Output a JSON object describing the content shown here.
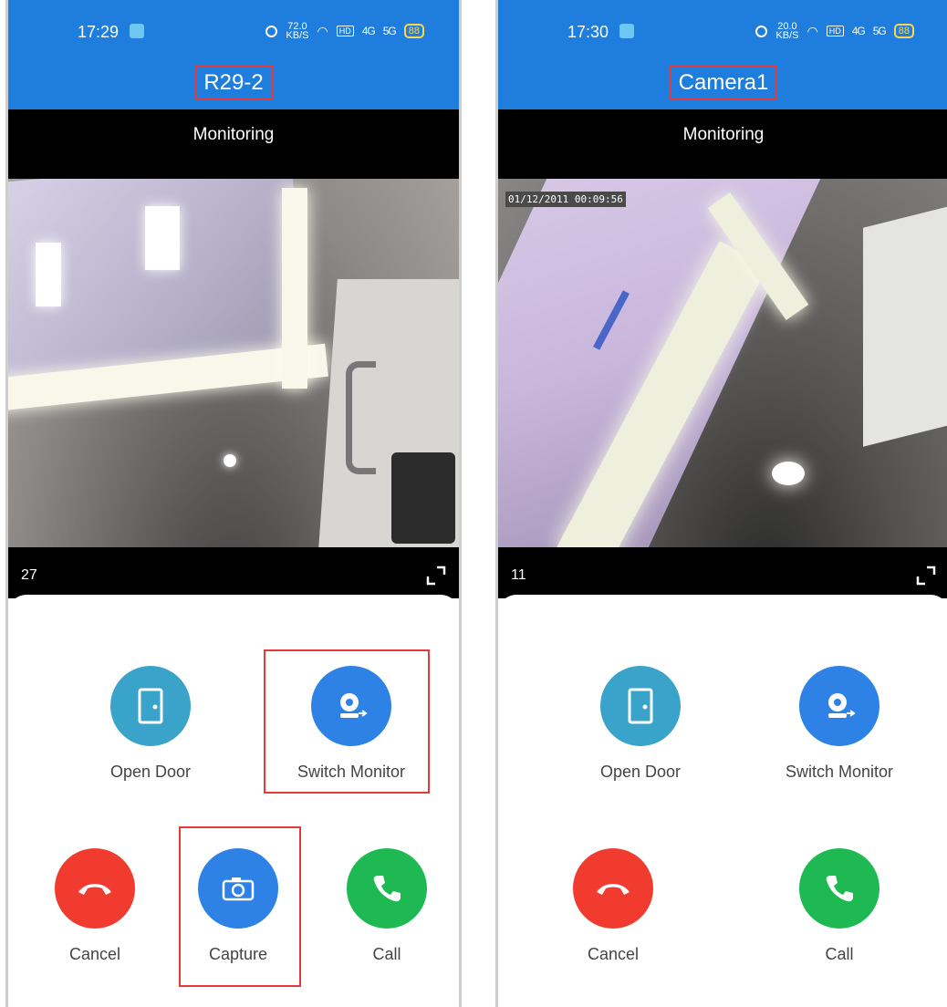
{
  "left_screen": {
    "status": {
      "time": "17:29",
      "speed": "72.0",
      "speed_unit": "KB/S",
      "hd": "HD",
      "sig1": "4G",
      "sig2": "5G",
      "battery": "88"
    },
    "title": "R29-2",
    "monitoring": "Monitoring",
    "counter": "27",
    "actions": {
      "open_door": "Open Door",
      "switch_monitor": "Switch Monitor",
      "cancel": "Cancel",
      "capture": "Capture",
      "call": "Call"
    }
  },
  "right_screen": {
    "status": {
      "time": "17:30",
      "speed": "20.0",
      "speed_unit": "KB/S",
      "hd": "HD",
      "sig1": "4G",
      "sig2": "5G",
      "battery": "88"
    },
    "title": "Camera1",
    "monitoring": "Monitoring",
    "osd": "01/12/2011 00:09:56",
    "counter": "11",
    "actions": {
      "open_door": "Open Door",
      "switch_monitor": "Switch Monitor",
      "cancel": "Cancel",
      "call": "Call"
    }
  },
  "colors": {
    "header": "#1f7ddd",
    "open_door": "#3aa3c9",
    "switch_monitor": "#2f82e5",
    "capture": "#2f82e5",
    "cancel": "#f23b2f",
    "call": "#1fb954",
    "highlight": "#e53a3a"
  },
  "icons": [
    "door-icon",
    "camera-switch-icon",
    "hangup-icon",
    "camera-icon",
    "phone-icon",
    "expand-icon"
  ]
}
